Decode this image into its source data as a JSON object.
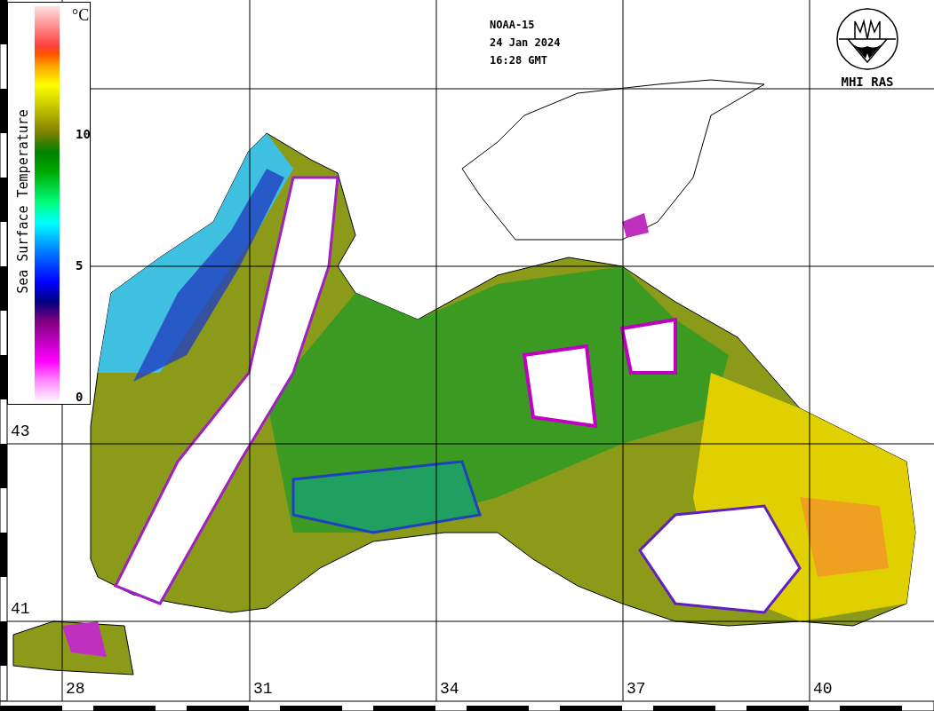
{
  "satellite": "NOAA-15",
  "date": "24 Jan 2024",
  "time": "16:28 GMT",
  "logo": {
    "label": "MHI RAS"
  },
  "legend": {
    "title": "Sea Surface Temperature",
    "unit": "°C",
    "ticks": [
      {
        "label": "10",
        "level": 0.667
      },
      {
        "label": "5",
        "level": 0.333
      },
      {
        "label": "0",
        "level": 0
      }
    ]
  },
  "latitude_labels": [
    "43",
    "41"
  ],
  "longitude_labels": [
    "28",
    "31",
    "34",
    "37",
    "40"
  ]
}
